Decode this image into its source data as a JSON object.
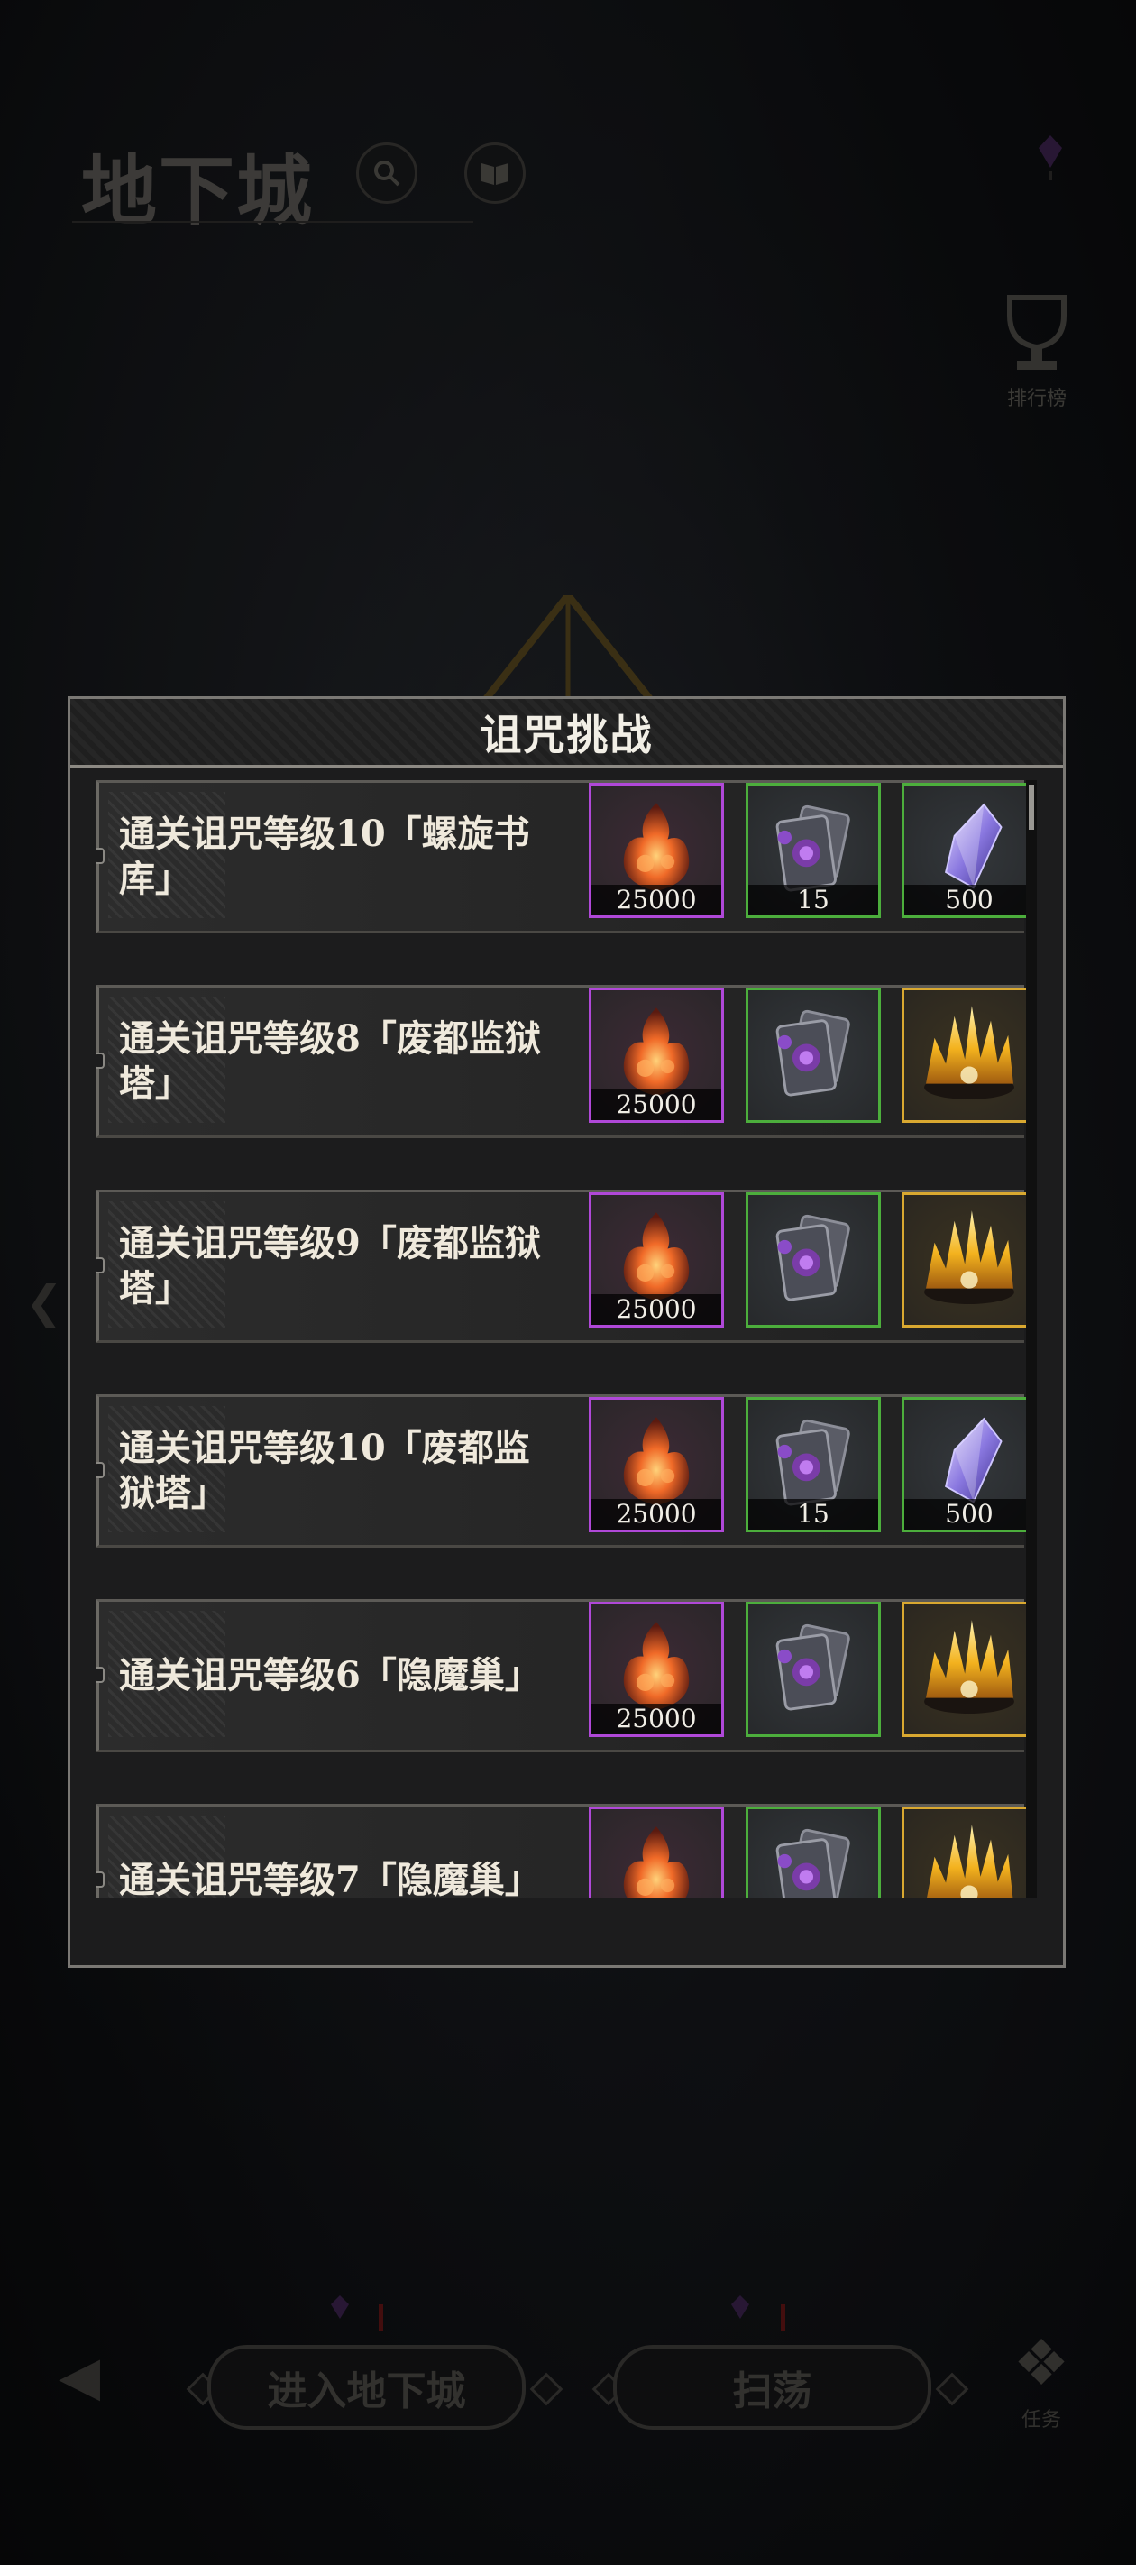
{
  "header": {
    "title": "地下城"
  },
  "side": {
    "rank_label": "排行榜",
    "task_label": "任务"
  },
  "modal": {
    "title": "诅咒挑战",
    "rows": [
      {
        "text": "通关诅咒等级10「螺旋书库」",
        "rewards": [
          {
            "type": "fire",
            "rarity": "purple",
            "count": "25000"
          },
          {
            "type": "cards",
            "rarity": "green",
            "count": "15"
          },
          {
            "type": "crystal",
            "rarity": "green",
            "count": "500"
          }
        ]
      },
      {
        "text": "通关诅咒等级8「废都监狱塔」",
        "rewards": [
          {
            "type": "fire",
            "rarity": "purple",
            "count": "25000"
          },
          {
            "type": "cards",
            "rarity": "green",
            "count": ""
          },
          {
            "type": "flame-crown",
            "rarity": "gold",
            "count": ""
          }
        ]
      },
      {
        "text": "通关诅咒等级9「废都监狱塔」",
        "rewards": [
          {
            "type": "fire",
            "rarity": "purple",
            "count": "25000"
          },
          {
            "type": "cards",
            "rarity": "green",
            "count": ""
          },
          {
            "type": "flame-crown",
            "rarity": "gold",
            "count": ""
          }
        ]
      },
      {
        "text": "通关诅咒等级10「废都监狱塔」",
        "rewards": [
          {
            "type": "fire",
            "rarity": "purple",
            "count": "25000"
          },
          {
            "type": "cards",
            "rarity": "green",
            "count": "15"
          },
          {
            "type": "crystal",
            "rarity": "green",
            "count": "500"
          }
        ]
      },
      {
        "text": "通关诅咒等级6「隐魔巢」",
        "rewards": [
          {
            "type": "fire",
            "rarity": "purple",
            "count": "25000"
          },
          {
            "type": "cards",
            "rarity": "green",
            "count": ""
          },
          {
            "type": "flame-crown",
            "rarity": "gold",
            "count": ""
          }
        ]
      },
      {
        "text": "通关诅咒等级7「隐魔巢」",
        "rewards": [
          {
            "type": "fire",
            "rarity": "purple",
            "count": ""
          },
          {
            "type": "cards",
            "rarity": "green",
            "count": ""
          },
          {
            "type": "flame-crown",
            "rarity": "gold",
            "count": ""
          }
        ]
      }
    ]
  },
  "footer": {
    "enter_label": "进入地下城",
    "sweep_label": "扫荡"
  },
  "colors": {
    "purple": "#b048d8",
    "green": "#4cae3c",
    "gold": "#d9a830"
  }
}
